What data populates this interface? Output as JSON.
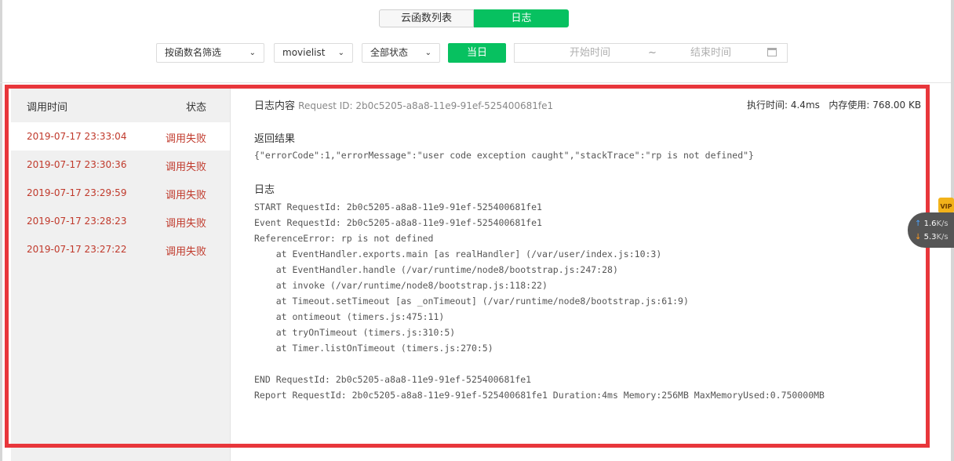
{
  "tabs": {
    "function_list": "云函数列表",
    "logs": "日志"
  },
  "filters": {
    "function_filter": "按函数名筛选",
    "function_name": "movielist",
    "status_filter": "全部状态",
    "today": "当日",
    "start_placeholder": "开始时间",
    "separator": "~",
    "end_placeholder": "结束时间"
  },
  "log_list": {
    "header_time": "调用时间",
    "header_status": "状态",
    "rows": [
      {
        "time": "2019-07-17 23:33:04",
        "status": "调用失败"
      },
      {
        "time": "2019-07-17 23:30:36",
        "status": "调用失败"
      },
      {
        "time": "2019-07-17 23:29:59",
        "status": "调用失败"
      },
      {
        "time": "2019-07-17 23:28:23",
        "status": "调用失败"
      },
      {
        "time": "2019-07-17 23:27:22",
        "status": "调用失败"
      }
    ]
  },
  "detail": {
    "title": "日志内容",
    "request_id": "Request ID: 2b0c5205-a8a8-11e9-91ef-525400681fe1",
    "exec_time": "执行时间: 4.4ms",
    "memory": "内存使用: 768.00 KB",
    "result_title": "返回结果",
    "result": "{\"errorCode\":1,\"errorMessage\":\"user code exception caught\",\"stackTrace\":\"rp is not defined\"}",
    "log_title": "日志",
    "log_text": "START RequestId: 2b0c5205-a8a8-11e9-91ef-525400681fe1\nEvent RequestId: 2b0c5205-a8a8-11e9-91ef-525400681fe1\nReferenceError: rp is not defined\n    at EventHandler.exports.main [as realHandler] (/var/user/index.js:10:3)\n    at EventHandler.handle (/var/runtime/node8/bootstrap.js:247:28)\n    at invoke (/var/runtime/node8/bootstrap.js:118:22)\n    at Timeout.setTimeout [as _onTimeout] (/var/runtime/node8/bootstrap.js:61:9)\n    at ontimeout (timers.js:475:11)\n    at tryOnTimeout (timers.js:310:5)\n    at Timer.listOnTimeout (timers.js:270:5)\n\nEND RequestId: 2b0c5205-a8a8-11e9-91ef-525400681fe1\nReport RequestId: 2b0c5205-a8a8-11e9-91ef-525400681fe1 Duration:4ms Memory:256MB MaxMemoryUsed:0.750000MB"
  },
  "speed_widget": {
    "up_value": "1.6",
    "down_value": "5.3",
    "unit": "K/s",
    "badge": "VIP"
  },
  "colors": {
    "accent": "#07c160",
    "error": "#c0392b",
    "highlight": "#e8363b"
  }
}
